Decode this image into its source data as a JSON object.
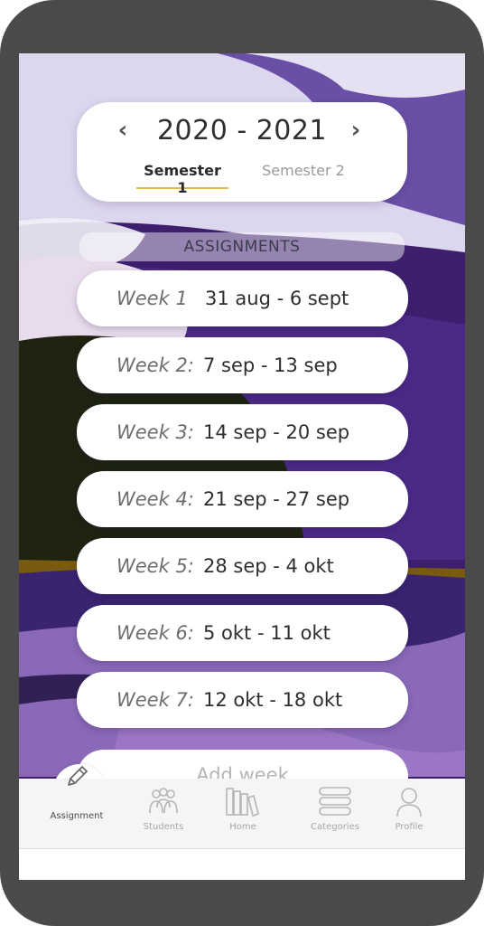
{
  "header": {
    "year_title": "2020 - 2021",
    "prev_glyph": "‹",
    "next_glyph": "›",
    "semesters": [
      "Semester 1",
      "Semester 2"
    ],
    "active_semester": "Semester 1"
  },
  "section_title": "ASSIGNMENTS",
  "weeks": [
    {
      "label": "Week 1",
      "range": "31 aug - 6 sept"
    },
    {
      "label": "Week 2:",
      "range": "7 sep - 13 sep"
    },
    {
      "label": "Week 3:",
      "range": "14 sep - 20 sep"
    },
    {
      "label": "Week 4:",
      "range": "21 sep - 27 sep"
    },
    {
      "label": "Week 5:",
      "range": "28 sep - 4 okt"
    },
    {
      "label": "Week 6:",
      "range": "5 okt  - 11 okt"
    },
    {
      "label": "Week 7:",
      "range": "12 okt  - 18 okt"
    }
  ],
  "add_week_label": "Add week",
  "nav": [
    {
      "label": "Assignment",
      "icon": "pencil-icon",
      "active": true
    },
    {
      "label": "Students",
      "icon": "students-icon",
      "active": false
    },
    {
      "label": "Home",
      "icon": "books-icon",
      "active": false
    },
    {
      "label": "Categories",
      "icon": "categories-icon",
      "active": false
    },
    {
      "label": "Profile",
      "icon": "profile-icon",
      "active": false
    }
  ],
  "colors": {
    "sky_lavender": "#d8d3ec",
    "deep_purple": "#3e1f6e",
    "mid_purple": "#5a3d96",
    "dark_hill": "#1e2410",
    "accent_gold": "#e1b94a"
  }
}
